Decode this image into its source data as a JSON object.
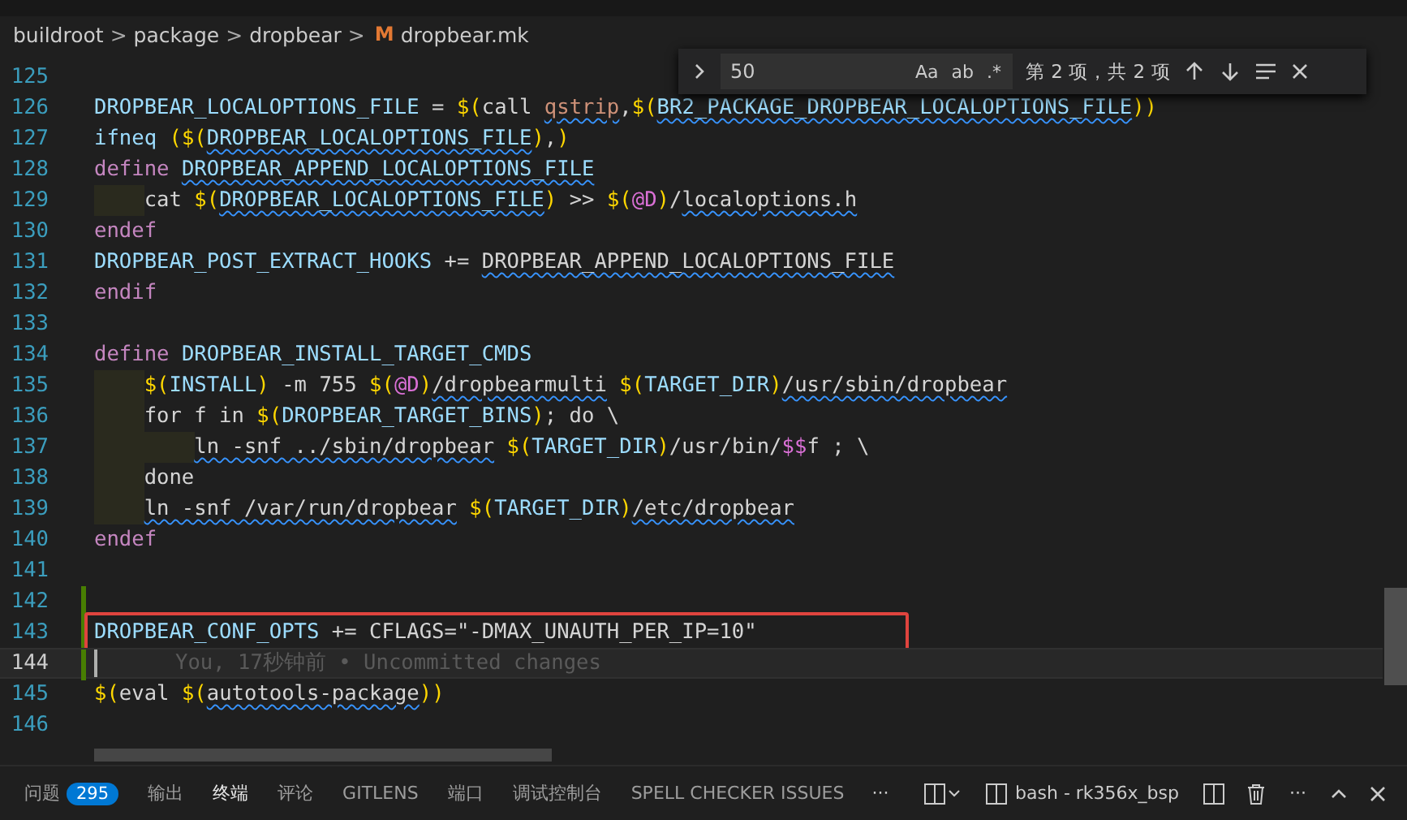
{
  "breadcrumb": {
    "items": [
      "buildroot",
      "package",
      "dropbear"
    ],
    "separator": ">",
    "file": "dropbear.mk",
    "file_icon": "M"
  },
  "find_widget": {
    "value": "50",
    "options": [
      {
        "label": "Aa",
        "selected": false
      },
      {
        "label": "ab",
        "selected": false
      },
      {
        "label": ".*",
        "selected": false
      }
    ],
    "result": "第 2 项，共 2 项"
  },
  "lines": [
    {
      "number": "125"
    },
    {
      "number": "126",
      "segments": [
        {
          "kind": "var",
          "text": "DROPBEAR_LOCALOPTIONS_FILE"
        },
        {
          "kind": "text",
          "text": " = "
        },
        {
          "kind": "paren",
          "text": "$("
        },
        {
          "kind": "text",
          "text": "call "
        },
        {
          "kind": "fn",
          "text": "qstrip",
          "squiggle": true
        },
        {
          "kind": "text",
          "text": ","
        },
        {
          "kind": "paren",
          "text": "$("
        },
        {
          "kind": "var",
          "text": "BR2_PACKAGE_DROPBEAR_LOCALOPTIONS_FILE",
          "squiggle": true
        },
        {
          "kind": "paren",
          "text": "))"
        }
      ]
    },
    {
      "number": "127",
      "segments": [
        {
          "kind": "var",
          "text": "ifneq "
        },
        {
          "kind": "paren",
          "text": "($("
        },
        {
          "kind": "var",
          "text": "DROPBEAR_LOCALOPTIONS_FILE",
          "squiggle": true
        },
        {
          "kind": "paren",
          "text": ")"
        },
        {
          "kind": "text",
          "text": ","
        },
        {
          "kind": "paren",
          "text": ")"
        }
      ]
    },
    {
      "number": "128",
      "segments": [
        {
          "kind": "kw",
          "text": "define "
        },
        {
          "kind": "var",
          "text": "DROPBEAR_APPEND_LOCALOPTIONS_FILE",
          "squiggle": true
        }
      ]
    },
    {
      "number": "129",
      "segments": [
        {
          "kind": "guide"
        },
        {
          "kind": "text",
          "text": "cat "
        },
        {
          "kind": "paren",
          "text": "$("
        },
        {
          "kind": "var",
          "text": "DROPBEAR_LOCALOPTIONS_FILE",
          "squiggle": true
        },
        {
          "kind": "paren",
          "text": ")"
        },
        {
          "kind": "text",
          "text": " >> "
        },
        {
          "kind": "paren",
          "text": "$("
        },
        {
          "kind": "at",
          "text": "@D"
        },
        {
          "kind": "paren",
          "text": ")"
        },
        {
          "kind": "text",
          "text": "/"
        },
        {
          "kind": "text",
          "text": "localoptions.h",
          "squiggle": true
        }
      ]
    },
    {
      "number": "130",
      "segments": [
        {
          "kind": "kw",
          "text": "endef"
        }
      ]
    },
    {
      "number": "131",
      "segments": [
        {
          "kind": "var",
          "text": "DROPBEAR_POST_EXTRACT_HOOKS"
        },
        {
          "kind": "text",
          "text": " += "
        },
        {
          "kind": "text",
          "text": "DROPBEAR_APPEND_LOCALOPTIONS_FILE",
          "squiggle": true
        }
      ]
    },
    {
      "number": "132",
      "segments": [
        {
          "kind": "kw",
          "text": "endif"
        }
      ]
    },
    {
      "number": "133"
    },
    {
      "number": "134",
      "segments": [
        {
          "kind": "kw",
          "text": "define "
        },
        {
          "kind": "var",
          "text": "DROPBEAR_INSTALL_TARGET_CMDS"
        }
      ]
    },
    {
      "number": "135",
      "segments": [
        {
          "kind": "guide"
        },
        {
          "kind": "paren",
          "text": "$("
        },
        {
          "kind": "var",
          "text": "INSTALL"
        },
        {
          "kind": "paren",
          "text": ")"
        },
        {
          "kind": "text",
          "text": " -m 755 "
        },
        {
          "kind": "paren",
          "text": "$("
        },
        {
          "kind": "at",
          "text": "@D"
        },
        {
          "kind": "paren",
          "text": ")"
        },
        {
          "kind": "text",
          "text": "/dropbearmulti",
          "squiggle": true
        },
        {
          "kind": "paren",
          "text": " $("
        },
        {
          "kind": "var",
          "text": "TARGET_DIR"
        },
        {
          "kind": "paren",
          "text": ")"
        },
        {
          "kind": "text",
          "text": "/usr/sbin/dropbear",
          "squiggle": true
        }
      ]
    },
    {
      "number": "136",
      "segments": [
        {
          "kind": "guide"
        },
        {
          "kind": "text",
          "text": "for f in "
        },
        {
          "kind": "paren",
          "text": "$("
        },
        {
          "kind": "var",
          "text": "DROPBEAR_TARGET_BINS"
        },
        {
          "kind": "paren",
          "text": ")"
        },
        {
          "kind": "text",
          "text": "; do \\"
        }
      ]
    },
    {
      "number": "137",
      "segments": [
        {
          "kind": "guide"
        },
        {
          "kind": "guide"
        },
        {
          "kind": "text",
          "text": "ln -snf ../sbin/dropbear",
          "squiggle": true
        },
        {
          "kind": "paren",
          "text": " $("
        },
        {
          "kind": "var",
          "text": "TARGET_DIR"
        },
        {
          "kind": "paren",
          "text": ")"
        },
        {
          "kind": "text",
          "text": "/usr/bin/"
        },
        {
          "kind": "at",
          "text": "$$"
        },
        {
          "kind": "text",
          "text": "f ; \\"
        }
      ]
    },
    {
      "number": "138",
      "segments": [
        {
          "kind": "guide"
        },
        {
          "kind": "text",
          "text": "done"
        }
      ]
    },
    {
      "number": "139",
      "segments": [
        {
          "kind": "guide"
        },
        {
          "kind": "text",
          "text": "ln -snf /var/run/dropbear",
          "squiggle": true
        },
        {
          "kind": "paren",
          "text": " $("
        },
        {
          "kind": "var",
          "text": "TARGET_DIR"
        },
        {
          "kind": "paren",
          "text": ")"
        },
        {
          "kind": "text",
          "text": "/etc/dropbear",
          "squiggle": true
        }
      ]
    },
    {
      "number": "140",
      "segments": [
        {
          "kind": "kw",
          "text": "endef"
        }
      ]
    },
    {
      "number": "141"
    },
    {
      "number": "142",
      "modified": true
    },
    {
      "number": "143",
      "segments": [
        {
          "kind": "var",
          "text": "DROPBEAR_CONF_OPTS"
        },
        {
          "kind": "text",
          "text": " += CFLAGS="
        },
        {
          "kind": "text",
          "text": "\"-DMAX_UNAUTH_PER_IP=10\""
        }
      ],
      "modified": true,
      "annotated": true
    },
    {
      "number": "144",
      "modified": true,
      "current": true,
      "annotated": true,
      "ghost": "You, 17秒钟前 • Uncommitted changes"
    },
    {
      "number": "145",
      "segments": [
        {
          "kind": "paren",
          "text": "$("
        },
        {
          "kind": "text",
          "text": "eval "
        },
        {
          "kind": "paren",
          "text": "$("
        },
        {
          "kind": "text",
          "text": "autotools-package",
          "squiggle": true
        },
        {
          "kind": "paren",
          "text": "))"
        }
      ]
    },
    {
      "number": "146"
    }
  ],
  "panel": {
    "tabs": [
      {
        "label": "问题",
        "badge": "295",
        "selected": false
      },
      {
        "label": "输出",
        "selected": false
      },
      {
        "label": "终端",
        "selected": true
      },
      {
        "label": "评论",
        "selected": false
      },
      {
        "label": "GITLENS",
        "selected": false
      },
      {
        "label": "端口",
        "selected": false
      },
      {
        "label": "调试控制台",
        "selected": false
      },
      {
        "label": "SPELL CHECKER ISSUES",
        "selected": false
      }
    ],
    "more": "···",
    "terminal": "bash - rk356x_bsp",
    "more_right": "···"
  }
}
